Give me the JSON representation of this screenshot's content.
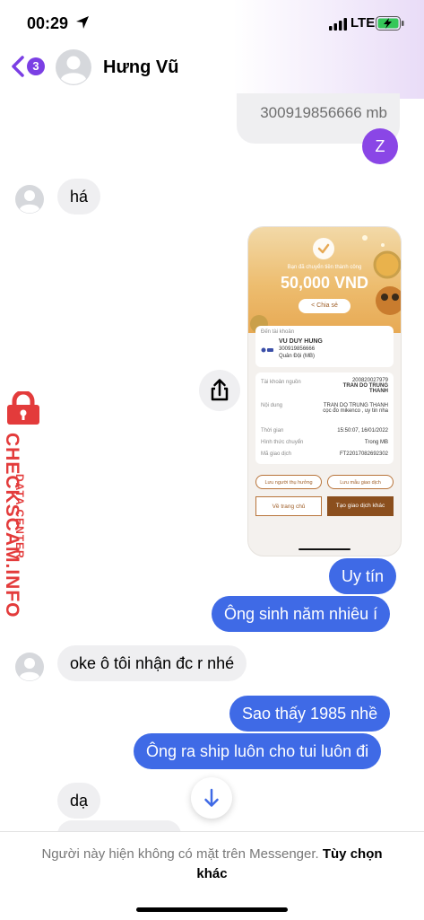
{
  "status_bar": {
    "time": "00:29",
    "network": "LTE"
  },
  "header": {
    "badge_count": "3",
    "contact_name": "Hưng Vũ",
    "back_icon": "chevron-left-icon"
  },
  "messages": {
    "quote_text": "300919856666 mb",
    "reaction_initial": "Z",
    "in_1": "há",
    "out_1": "Uy tín",
    "out_2": "Ông sinh năm nhiêu í",
    "in_2": "oke ô tôi nhận đc r nhé",
    "out_3": "Sao thấy 1985 nhề",
    "out_4": "Ông ra ship luôn cho tui luôn đi",
    "in_3": "dạ"
  },
  "receipt": {
    "subtitle": "Bạn đã chuyển tiền thành công",
    "amount": "50,000 VND",
    "share_label": "Chia sẻ",
    "to_label": "Đến tài khoản",
    "recipient_name": "VU DUY HUNG",
    "recipient_account": "300919856666",
    "recipient_bank": "Quân Đội (MB)",
    "source_label": "Tài khoản nguồn",
    "source_account": "200820027979",
    "source_name": "TRAN DO TRUNG THANH",
    "content_label": "Nội dung",
    "content_value": "TRAN DO TRUNG THANH cọc đo mikenco , uy tin nha",
    "time_label": "Thời gian",
    "time_value": "15:50:07, 16/01/2022",
    "method_label": "Hình thức chuyển",
    "method_value": "Trong MB",
    "txn_label": "Mã giao dịch",
    "txn_value": "FT22017082692302",
    "save_recipient": "Lưu người thụ hưởng",
    "save_template": "Lưu mẫu giao dịch",
    "home_button": "Về trang chủ",
    "new_txn_button": "Tạo giao dịch khác"
  },
  "watermark": {
    "top": "DATA CENTER",
    "main": "CHECKSCAM.INFO"
  },
  "footer": {
    "notice": "Người này hiện không có mặt trên Messenger.",
    "link": "Tùy chọn khác"
  },
  "colors": {
    "outgoing": "#3f6ae6",
    "incoming": "#efeff1",
    "accent": "#7b3fe4",
    "watermark": "#e33b3b"
  }
}
